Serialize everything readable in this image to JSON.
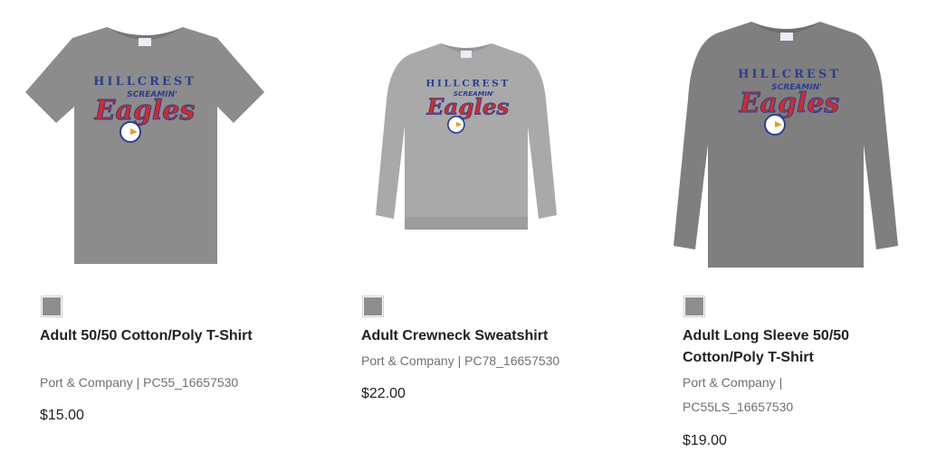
{
  "products": [
    {
      "title": "Adult 50/50 Cotton/Poly T-Shirt",
      "meta": "Port & Company | PC55_16657530",
      "price": "$15.00",
      "swatch_color": "#8e8e8e",
      "garment_color": "#8c8c8c",
      "garment": "t-shirt"
    },
    {
      "title": "Adult Crewneck Sweatshirt",
      "meta": "Port & Company | PC78_16657530",
      "price": "$22.00",
      "swatch_color": "#8e8e8e",
      "garment_color": "#a9a9a9",
      "garment": "sweatshirt"
    },
    {
      "title": "Adult Long Sleeve 50/50 Cotton/Poly T-Shirt",
      "meta": "Port & Company | PC55LS_16657530",
      "price": "$19.00",
      "swatch_color": "#8e8e8e",
      "garment_color": "#7f7f7f",
      "garment": "long-sleeve"
    }
  ],
  "design": {
    "arc_text": "HILLCREST",
    "script_small": "SCREAMIN'",
    "script_large": "Eagles",
    "red": "#d42a2a",
    "blue": "#2b3f8f"
  }
}
